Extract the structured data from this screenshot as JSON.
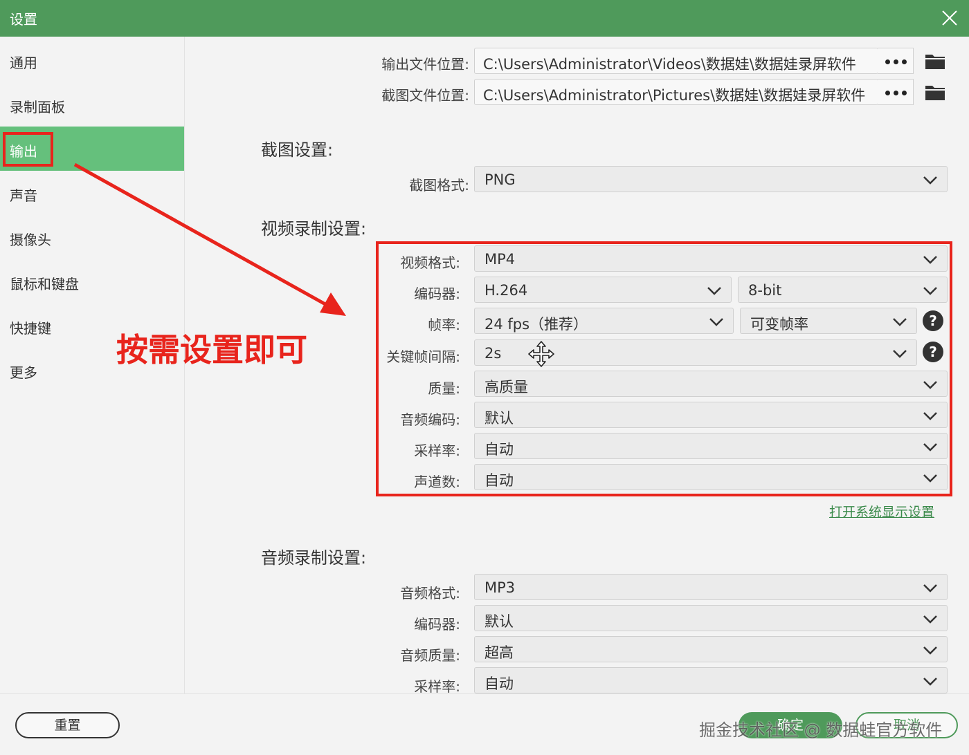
{
  "window": {
    "title": "设置",
    "close_icon": "close-icon"
  },
  "sidebar": {
    "items": [
      {
        "label": "通用"
      },
      {
        "label": "录制面板"
      },
      {
        "label": "输出",
        "active": true
      },
      {
        "label": "声音"
      },
      {
        "label": "摄像头"
      },
      {
        "label": "鼠标和键盘"
      },
      {
        "label": "快捷键"
      },
      {
        "label": "更多"
      }
    ]
  },
  "output_paths": {
    "output_label": "输出文件位置:",
    "output_value": "C:\\Users\\Administrator\\Videos\\数据娃\\数据娃录屏软件",
    "screenshot_label": "截图文件位置:",
    "screenshot_value": "C:\\Users\\Administrator\\Pictures\\数据娃\\数据娃录屏软件"
  },
  "screenshot_settings": {
    "title": "截图设置:",
    "format_label": "截图格式:",
    "format_value": "PNG"
  },
  "video_settings": {
    "title": "视频录制设置:",
    "format_label": "视频格式:",
    "format_value": "MP4",
    "encoder_label": "编码器:",
    "encoder_value": "H.264",
    "bitdepth_value": "8-bit",
    "framerate_label": "帧率:",
    "framerate_value": "24 fps（推荐）",
    "framerate_mode_value": "可变帧率",
    "keyframe_label": "关键帧间隔:",
    "keyframe_value": "2s",
    "quality_label": "质量:",
    "quality_value": "高质量",
    "audio_codec_label": "音频编码:",
    "audio_codec_value": "默认",
    "samplerate_label": "采样率:",
    "samplerate_value": "自动",
    "channels_label": "声道数:",
    "channels_value": "自动",
    "display_link": "打开系统显示设置"
  },
  "audio_settings": {
    "title": "音频录制设置:",
    "format_label": "音频格式:",
    "format_value": "MP3",
    "encoder_label": "编码器:",
    "encoder_value": "默认",
    "quality_label": "音频质量:",
    "quality_value": "超高",
    "samplerate_label": "采样率:",
    "samplerate_value": "自动"
  },
  "annotation": {
    "text": "按需设置即可",
    "color": "#e8241c"
  },
  "footer": {
    "reset_label": "重置",
    "ok_label": "确定",
    "cancel_label": "取消",
    "watermark": "掘金技术社区 @ 数据蛙官方软件"
  },
  "colors": {
    "brand": "#4f9a5b",
    "active": "#65c07c",
    "highlight": "#e8241c"
  }
}
